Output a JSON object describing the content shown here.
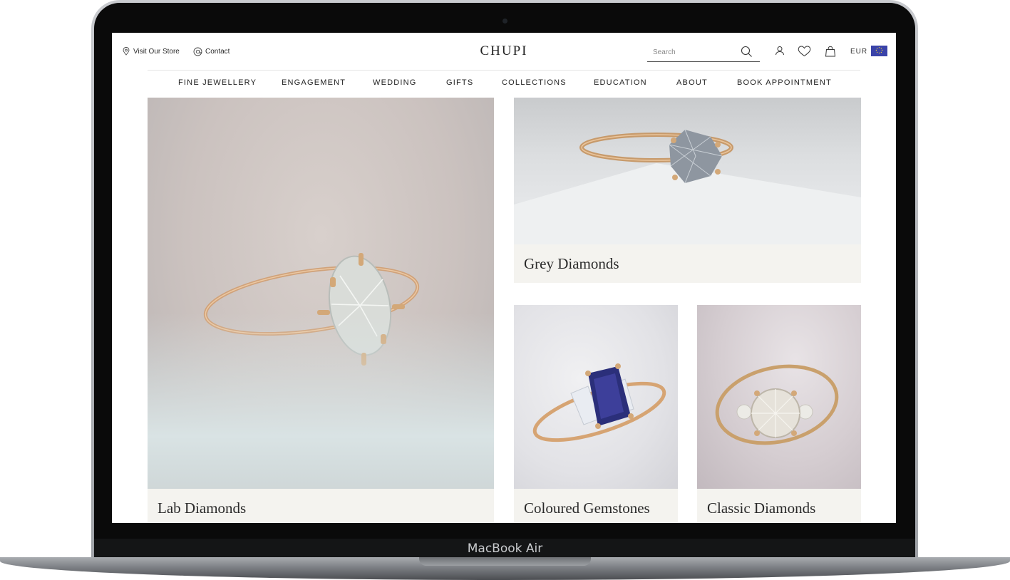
{
  "device": {
    "label": "MacBook Air"
  },
  "header": {
    "visit_store": "Visit Our Store",
    "contact": "Contact",
    "logo": "CHUPI",
    "search_placeholder": "Search",
    "currency": "EUR"
  },
  "nav": {
    "items": [
      {
        "label": "FINE JEWELLERY"
      },
      {
        "label": "ENGAGEMENT"
      },
      {
        "label": "WEDDING"
      },
      {
        "label": "GIFTS"
      },
      {
        "label": "COLLECTIONS"
      },
      {
        "label": "EDUCATION"
      },
      {
        "label": "ABOUT"
      },
      {
        "label": "BOOK APPOINTMENT"
      }
    ]
  },
  "tiles": [
    {
      "label": "Lab Diamonds"
    },
    {
      "label": "Grey Diamonds"
    },
    {
      "label": "Coloured Gemstones"
    },
    {
      "label": "Classic Diamonds"
    }
  ],
  "colors": {
    "caption_bg": "#f4f3ef",
    "text": "#222222",
    "flag": "#3a43a9",
    "gold": "#d3a878",
    "sapphire": "#2b2f7a"
  },
  "icons": [
    "location-pin-icon",
    "at-sign-icon",
    "search-icon",
    "user-icon",
    "heart-icon",
    "shopping-bag-icon",
    "eu-flag-icon"
  ]
}
